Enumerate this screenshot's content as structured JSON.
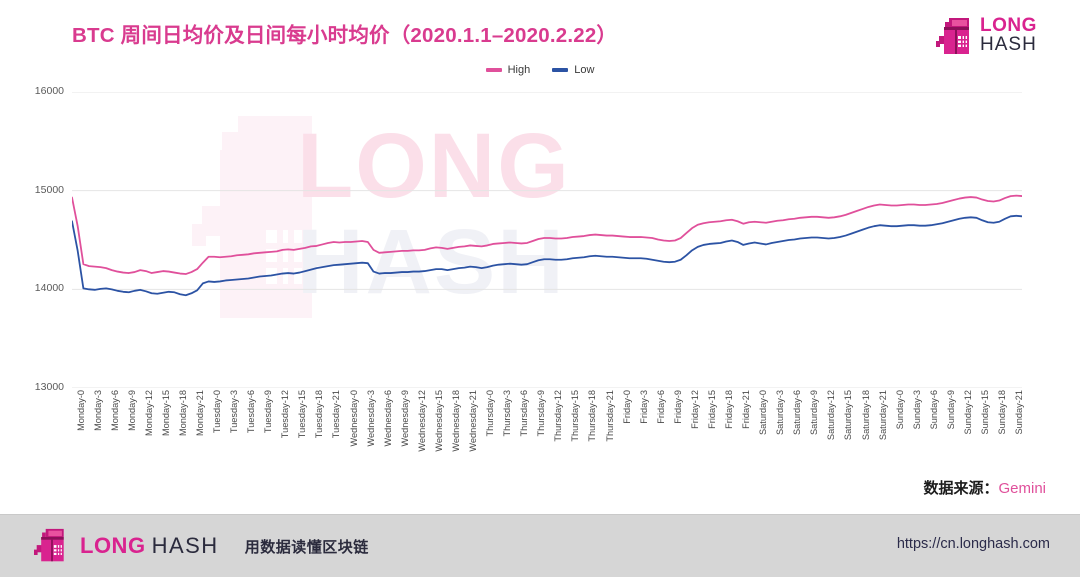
{
  "header": {
    "title": "BTC 周间日均价及日间每小时均价（2020.1.1–2020.2.22）",
    "logo_line1": "LONG",
    "logo_line2": "HASH"
  },
  "legend": {
    "position": "top-center",
    "items": [
      {
        "label": "High",
        "color": "#e0509b"
      },
      {
        "label": "Low",
        "color": "#2c53a4"
      }
    ]
  },
  "source": {
    "label": "数据来源：",
    "value": "Gemini"
  },
  "footer": {
    "logo_line1": "LONG",
    "logo_line2": "HASH",
    "tagline": "用数据读懂区块链",
    "url": "https://cn.longhash.com"
  },
  "watermark": {
    "line1": "LONG",
    "line2": "HASH"
  },
  "chart_data": {
    "type": "line",
    "title": "BTC 周间日均价及日间每小时均价（2020.1.1–2020.2.22）",
    "xlabel": "",
    "ylabel": "",
    "ylim": [
      13000,
      16000
    ],
    "yticks": [
      13000,
      14000,
      15000,
      16000
    ],
    "ytick_labels": [
      "13000",
      "14000",
      "15000",
      "16000"
    ],
    "grid": true,
    "legend_position": "top-center",
    "x_tick_step_hours": 3,
    "x_tick_labels": [
      "Monday-0",
      "Monday-3",
      "Monday-6",
      "Monday-9",
      "Monday-12",
      "Monday-15",
      "Monday-18",
      "Monday-21",
      "Tuesday-0",
      "Tuesday-3",
      "Tuesday-6",
      "Tuesday-9",
      "Tuesday-12",
      "Tuesday-15",
      "Tuesday-18",
      "Tuesday-21",
      "Wednesday-0",
      "Wednesday-3",
      "Wednesday-6",
      "Wednesday-9",
      "Wednesday-12",
      "Wednesday-15",
      "Wednesday-18",
      "Wednesday-21",
      "Thursday-0",
      "Thursday-3",
      "Thursday-6",
      "Thursday-9",
      "Thursday-12",
      "Thursday-15",
      "Thursday-18",
      "Thursday-21",
      "Friday-0",
      "Friday-3",
      "Friday-6",
      "Friday-9",
      "Friday-12",
      "Friday-15",
      "Friday-18",
      "Friday-21",
      "Saturday-0",
      "Saturday-3",
      "Saturday-6",
      "Saturday-9",
      "Saturday-12",
      "Saturday-15",
      "Saturday-18",
      "Saturday-21",
      "Sunday-0",
      "Sunday-3",
      "Sunday-6",
      "Sunday-9",
      "Sunday-12",
      "Sunday-15",
      "Sunday-18",
      "Sunday-21"
    ],
    "series": [
      {
        "name": "High",
        "color": "#e0509b",
        "values": [
          14930,
          14640,
          14255,
          14235,
          14230,
          14225,
          14215,
          14195,
          14180,
          14170,
          14165,
          14175,
          14195,
          14185,
          14165,
          14175,
          14185,
          14180,
          14170,
          14160,
          14155,
          14175,
          14205,
          14270,
          14330,
          14330,
          14325,
          14330,
          14335,
          14345,
          14350,
          14355,
          14365,
          14370,
          14375,
          14380,
          14385,
          14400,
          14405,
          14400,
          14410,
          14420,
          14435,
          14440,
          14455,
          14470,
          14480,
          14475,
          14480,
          14480,
          14485,
          14490,
          14480,
          14400,
          14370,
          14375,
          14380,
          14385,
          14390,
          14390,
          14395,
          14395,
          14400,
          14415,
          14425,
          14420,
          14410,
          14420,
          14430,
          14435,
          14445,
          14440,
          14435,
          14445,
          14460,
          14465,
          14470,
          14475,
          14470,
          14465,
          14470,
          14490,
          14510,
          14520,
          14520,
          14515,
          14515,
          14520,
          14530,
          14535,
          14540,
          14550,
          14555,
          14550,
          14545,
          14545,
          14540,
          14535,
          14530,
          14530,
          14530,
          14525,
          14520,
          14505,
          14495,
          14490,
          14495,
          14520,
          14570,
          14620,
          14655,
          14670,
          14680,
          14685,
          14690,
          14700,
          14705,
          14690,
          14665,
          14680,
          14685,
          14680,
          14675,
          14685,
          14695,
          14700,
          14710,
          14715,
          14725,
          14730,
          14735,
          14735,
          14730,
          14725,
          14730,
          14740,
          14755,
          14775,
          14795,
          14815,
          14835,
          14850,
          14860,
          14855,
          14850,
          14850,
          14855,
          14860,
          14860,
          14855,
          14855,
          14860,
          14865,
          14875,
          14890,
          14905,
          14920,
          14930,
          14935,
          14930,
          14910,
          14895,
          14890,
          14900,
          14925,
          14945,
          14950,
          14945
        ]
      },
      {
        "name": "Low",
        "color": "#2c53a4",
        "values": [
          14690,
          14390,
          14010,
          14000,
          13995,
          14005,
          14010,
          14000,
          13985,
          13975,
          13970,
          13985,
          13995,
          13980,
          13960,
          13955,
          13965,
          13975,
          13970,
          13950,
          13940,
          13960,
          13990,
          14060,
          14080,
          14075,
          14080,
          14090,
          14095,
          14100,
          14105,
          14110,
          14120,
          14130,
          14135,
          14140,
          14150,
          14160,
          14165,
          14160,
          14170,
          14185,
          14200,
          14215,
          14225,
          14235,
          14245,
          14250,
          14255,
          14260,
          14265,
          14270,
          14265,
          14180,
          14160,
          14165,
          14165,
          14170,
          14175,
          14175,
          14180,
          14180,
          14185,
          14195,
          14205,
          14205,
          14195,
          14205,
          14215,
          14220,
          14230,
          14225,
          14215,
          14225,
          14240,
          14250,
          14255,
          14260,
          14255,
          14250,
          14255,
          14275,
          14295,
          14305,
          14305,
          14300,
          14300,
          14305,
          14315,
          14320,
          14325,
          14335,
          14340,
          14335,
          14330,
          14330,
          14325,
          14320,
          14315,
          14315,
          14315,
          14310,
          14300,
          14290,
          14280,
          14275,
          14280,
          14300,
          14345,
          14395,
          14430,
          14450,
          14460,
          14465,
          14470,
          14485,
          14495,
          14480,
          14450,
          14465,
          14475,
          14465,
          14455,
          14470,
          14480,
          14490,
          14500,
          14505,
          14515,
          14520,
          14525,
          14525,
          14520,
          14515,
          14520,
          14530,
          14545,
          14565,
          14585,
          14605,
          14625,
          14640,
          14650,
          14645,
          14640,
          14640,
          14645,
          14650,
          14650,
          14645,
          14645,
          14650,
          14660,
          14670,
          14685,
          14700,
          14715,
          14725,
          14730,
          14725,
          14700,
          14680,
          14675,
          14685,
          14715,
          14740,
          14745,
          14740
        ]
      }
    ]
  }
}
